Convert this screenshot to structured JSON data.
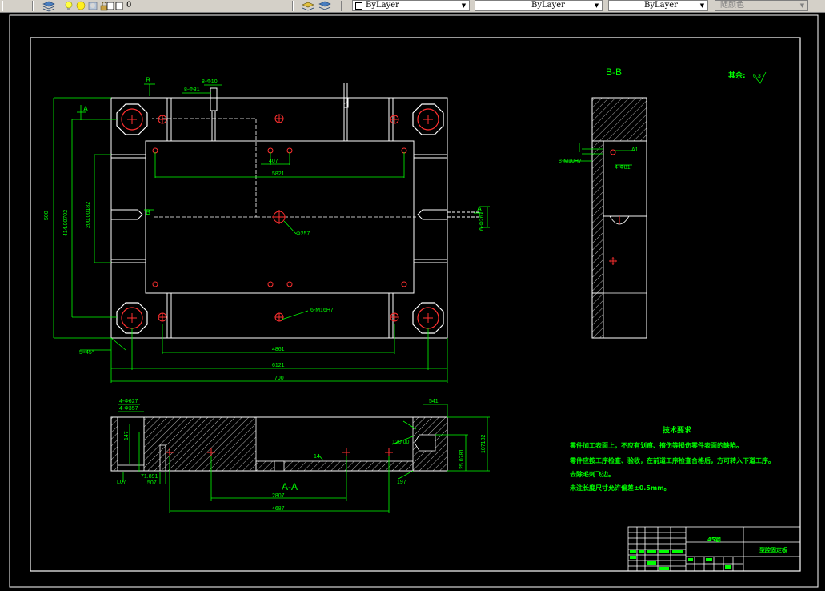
{
  "toolbar": {
    "layer_name": "0",
    "color_combo": "ByLayer",
    "linetype_combo": "ByLayer",
    "lineweight_combo": "ByLayer",
    "plotstyle_combo": "随颜色"
  },
  "drawing": {
    "plan_view": {
      "dims": {
        "overall_height": "500",
        "h2": "414.00702",
        "h3": "200.00182",
        "top_small": "20",
        "top_label": "8-Φ10",
        "top_label2": "8-Φ31",
        "w_407": "407",
        "w_5821": "5821",
        "phi_bottom": "Φ257",
        "m_callout": "6-M16H7",
        "right_vertical": "6-Φ267",
        "chamfer": "5×45°",
        "w_4861": "4861",
        "w_6121": "6121",
        "w_700": "700"
      },
      "section_marks": {
        "b_top": "B",
        "b_mid": "B",
        "a_left": "A",
        "a_right": "A"
      }
    },
    "section_bb": {
      "title": "B-B",
      "label_left": "8-M10H7",
      "label_right": "4-Φ81",
      "mark": "A1"
    },
    "section_aa": {
      "title": "A-A",
      "labels": {
        "l1": "4-Φ627",
        "l2": "4-Φ357",
        "dim_s47": "541",
        "dim_right": "107182",
        "dim_right2": "25.0781",
        "dim_sq": "120.00",
        "d_l07": "L07",
        "d_71": "71.891",
        "d_507": "507",
        "d_2807": "2807",
        "d_4687": "4687",
        "d_197": "197",
        "d_14": "14",
        "d_l47": "147"
      }
    },
    "roughness": {
      "text": "其余:",
      "value": "6.3"
    },
    "tech_req": {
      "title": "技术要求",
      "lines": [
        "零件加工表面上，不应有划痕、擦伤等损伤零件表面的缺陷。",
        "零件应按工序检查、验收，在前道工序检查合格后，方可转入下道工序。",
        "去除毛刺飞边。",
        "未注长度尺寸允许偏差±0.5mm。"
      ]
    },
    "title_block": {
      "material": "45钢",
      "part_name": "型腔固定板"
    }
  }
}
